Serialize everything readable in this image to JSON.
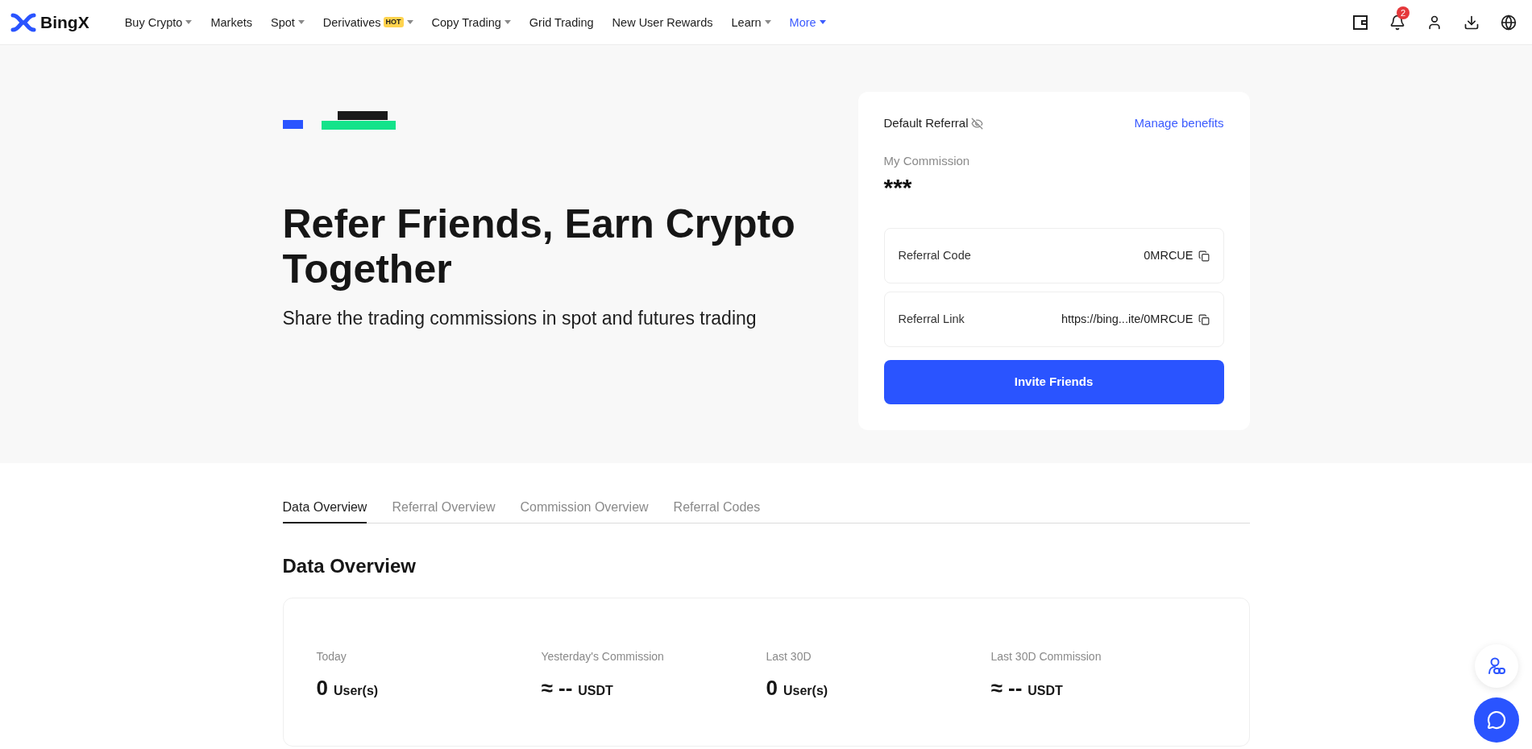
{
  "nav": {
    "logo": "BingX",
    "items": [
      {
        "label": "Buy Crypto",
        "dropdown": true,
        "selected": false
      },
      {
        "label": "Markets",
        "dropdown": false,
        "selected": false
      },
      {
        "label": "Spot",
        "dropdown": true,
        "selected": false
      },
      {
        "label": "Derivatives",
        "badge": "HOT",
        "dropdown": true,
        "selected": false
      },
      {
        "label": "Copy Trading",
        "dropdown": true,
        "selected": false
      },
      {
        "label": "Grid Trading",
        "dropdown": false,
        "selected": false
      },
      {
        "label": "New User Rewards",
        "dropdown": false,
        "selected": false
      },
      {
        "label": "Learn",
        "dropdown": true,
        "selected": false
      },
      {
        "label": "More",
        "dropdown": true,
        "selected": true
      }
    ],
    "notification_count": "2"
  },
  "hero": {
    "title": "Refer Friends, Earn Crypto Together",
    "subtitle": "Share the trading commissions in spot and futures trading"
  },
  "referral_card": {
    "title": "Default Referral",
    "manage_link": "Manage benefits",
    "commission_label": "My Commission",
    "commission_value": "***",
    "fields": [
      {
        "label": "Referral Code",
        "value": "0MRCUE"
      },
      {
        "label": "Referral Link",
        "value": "https://bing...ite/0MRCUE"
      }
    ],
    "button": "Invite Friends"
  },
  "tabs": [
    {
      "label": "Data Overview",
      "selected": true
    },
    {
      "label": "Referral Overview",
      "selected": false
    },
    {
      "label": "Commission Overview",
      "selected": false
    },
    {
      "label": "Referral Codes",
      "selected": false
    }
  ],
  "section_title": "Data Overview",
  "stats": [
    {
      "label": "Today",
      "value": "0",
      "unit": "User(s)"
    },
    {
      "label": "Yesterday's Commission",
      "value": "≈ --",
      "unit": "USDT"
    },
    {
      "label": "Last 30D",
      "value": "0",
      "unit": "User(s)"
    },
    {
      "label": "Last 30D Commission",
      "value": "≈ --",
      "unit": "USDT"
    }
  ]
}
